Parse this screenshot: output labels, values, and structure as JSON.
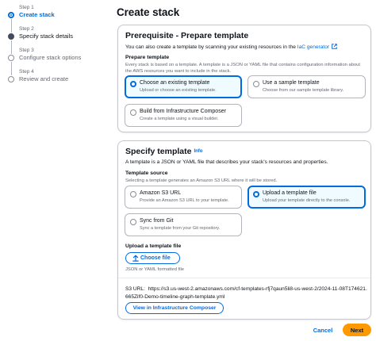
{
  "stepper": {
    "steps": [
      {
        "num": "Step 1",
        "label": "Create stack",
        "state": "active"
      },
      {
        "num": "Step 2",
        "label": "Specify stack details",
        "state": "done"
      },
      {
        "num": "Step 3",
        "label": "Configure stack options",
        "state": "pending"
      },
      {
        "num": "Step 4",
        "label": "Review and create",
        "state": "pending"
      }
    ]
  },
  "page_title": "Create stack",
  "prerequisite": {
    "title": "Prerequisite - Prepare template",
    "desc_text": "You can also create a template by scanning your existing resources in the",
    "desc_link": "IaC generator",
    "prepare_label": "Prepare template",
    "prepare_desc": "Every stack is based on a template. A template is a JSON or YAML file that contains configuration information about the AWS resources you want to include in the stack.",
    "options": [
      {
        "title": "Choose an existing template",
        "desc": "Upload or choose an existing template.",
        "selected": true
      },
      {
        "title": "Use a sample template",
        "desc": "Choose from our sample template library.",
        "selected": false
      },
      {
        "title": "Build from Infrastructure Composer",
        "desc": "Create a template using a visual builder.",
        "selected": false
      }
    ]
  },
  "specify": {
    "title": "Specify template",
    "info": "Info",
    "desc": "A template is a JSON or YAML file that describes your stack's resources and properties.",
    "source_label": "Template source",
    "source_desc": "Selecting a template generates an Amazon S3 URL where it will be stored.",
    "options": [
      {
        "title": "Amazon S3 URL",
        "desc": "Provide an Amazon S3 URL to your template.",
        "selected": false
      },
      {
        "title": "Upload a template file",
        "desc": "Upload your template directly to the console.",
        "selected": true
      },
      {
        "title": "Sync from Git",
        "desc": "Sync a template from your Git repository.",
        "selected": false
      }
    ],
    "upload_label": "Upload a template file",
    "choose_button": "Choose file",
    "file_hint": "JSON or YAML formatted file",
    "s3_url_label": "S3 URL:",
    "s3_url_value": "https://s3.us-west-2.amazonaws.com/cf-templates-rfj7qaun5li8-us-west-2/2024-11-08T174621.665Zif0-Demo-timeline-graph-template.yml",
    "view_button": "View in Infrastructure Composer"
  },
  "footer": {
    "cancel": "Cancel",
    "next": "Next"
  },
  "colors": {
    "accent": "#006ce0",
    "primary_button": "#ff9900",
    "selected_tile_bg": "#f0fbff"
  }
}
